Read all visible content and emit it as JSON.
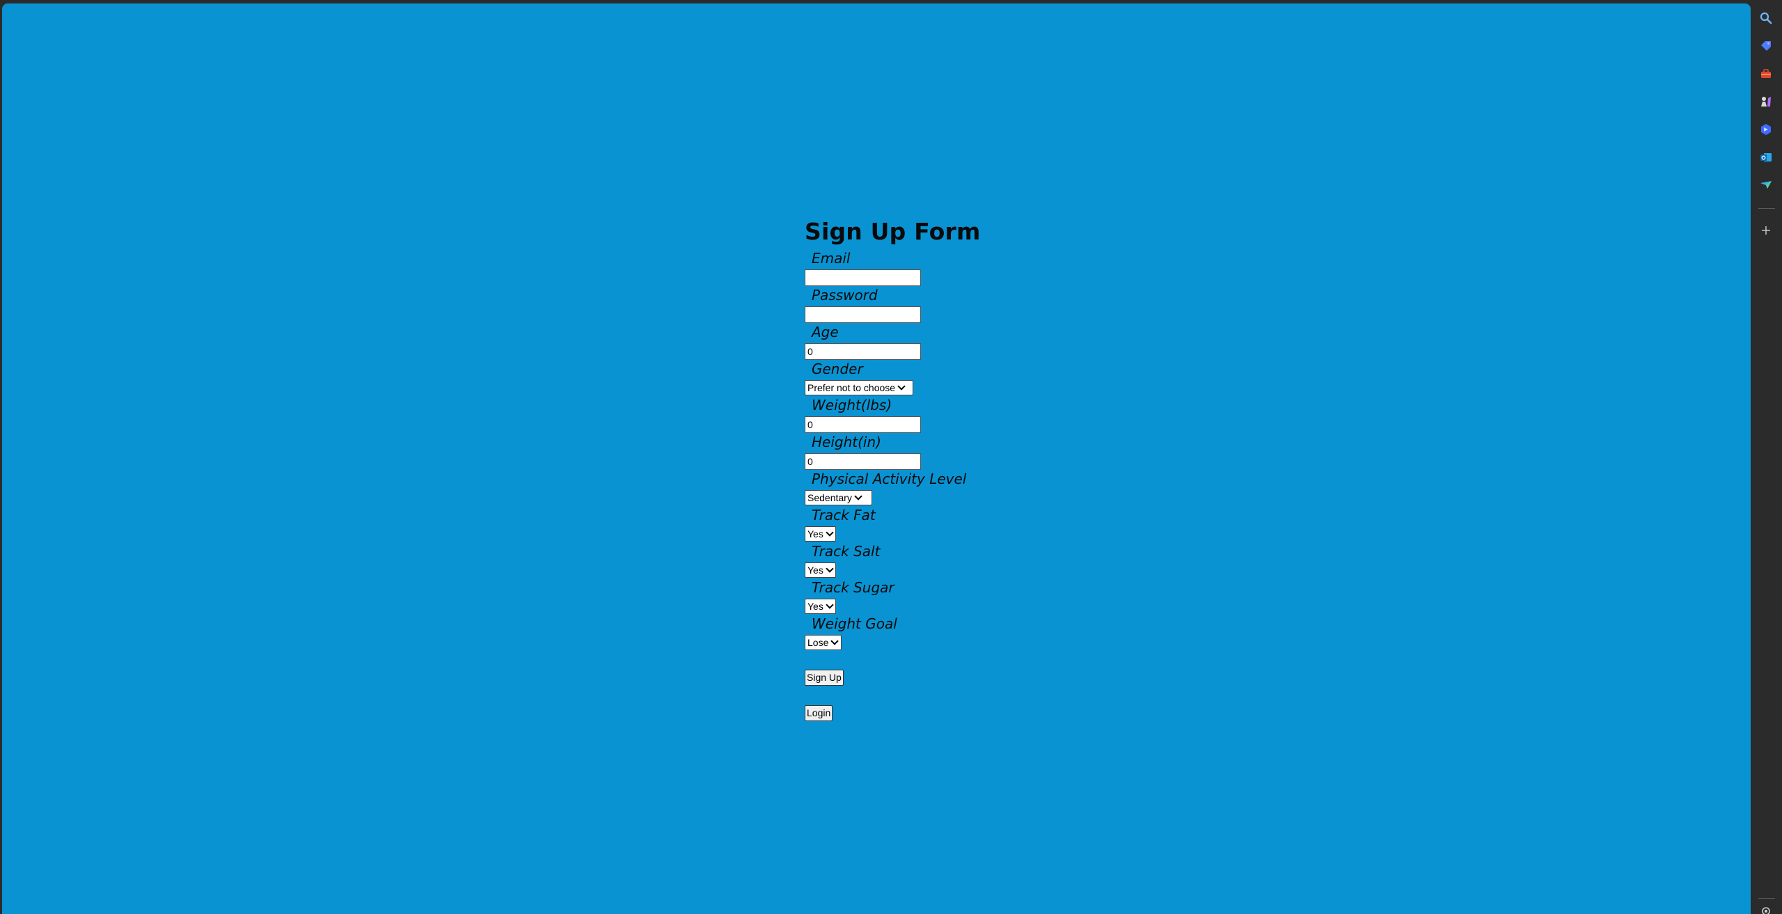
{
  "form": {
    "title": "Sign Up Form",
    "fields": {
      "email": {
        "label": "Email",
        "value": ""
      },
      "password": {
        "label": "Password",
        "value": ""
      },
      "age": {
        "label": "Age",
        "value": "0"
      },
      "gender": {
        "label": "Gender",
        "selected": "Prefer not to choose"
      },
      "weight": {
        "label": "Weight(lbs)",
        "value": "0"
      },
      "height": {
        "label": "Height(in)",
        "value": "0"
      },
      "activity": {
        "label": "Physical Activity Level",
        "selected": "Sedentary"
      },
      "track_fat": {
        "label": "Track Fat",
        "selected": "Yes"
      },
      "track_salt": {
        "label": "Track Salt",
        "selected": "Yes"
      },
      "track_sugar": {
        "label": "Track Sugar",
        "selected": "Yes"
      },
      "weight_goal": {
        "label": "Weight Goal",
        "selected": "Lose"
      }
    },
    "buttons": {
      "signup": "Sign Up",
      "login": "Login"
    }
  },
  "sidebar": {
    "icons": [
      "search-icon",
      "tag-icon",
      "toolbox-icon",
      "chess-icon",
      "copilot-icon",
      "outlook-icon",
      "send-icon",
      "add-icon",
      "settings-icon"
    ],
    "colors": {
      "background": "#2b2b2b",
      "page": "#0993d3"
    }
  }
}
